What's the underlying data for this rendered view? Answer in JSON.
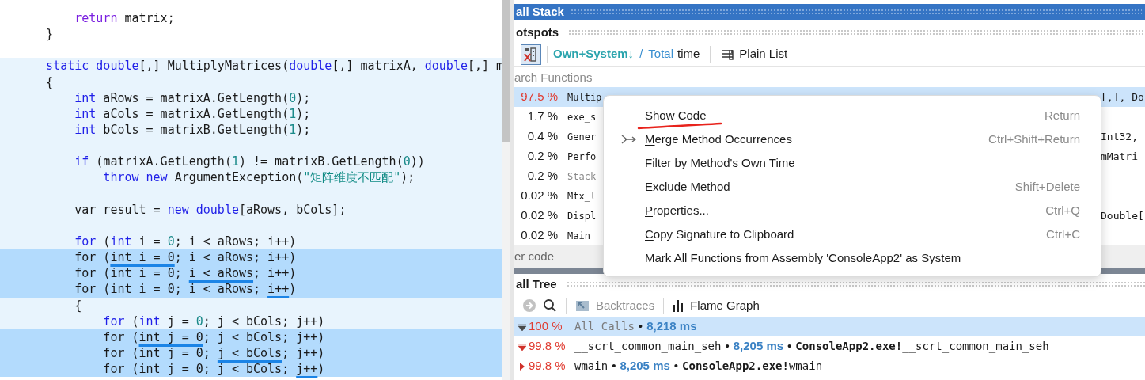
{
  "editor": {
    "lines": [
      {
        "selected": false,
        "tokens": [
          {
            "kind": "flow",
            "text": "        return"
          },
          {
            "kind": "plain",
            "text": " matrix;"
          }
        ]
      },
      {
        "selected": false,
        "tokens": [
          {
            "kind": "plain",
            "text": "    }"
          }
        ]
      },
      {
        "kind": "blank"
      }
    ],
    "scope": {
      "highlighted": true,
      "lines": [
        {
          "selected": false,
          "tokens": [
            {
              "kind": "keyword",
              "text": "    static double"
            },
            {
              "kind": "plain",
              "text": "[,] MultiplyMatrices("
            },
            {
              "kind": "keyword",
              "text": "double"
            },
            {
              "kind": "plain",
              "text": "[,] matrixA, "
            },
            {
              "kind": "keyword",
              "text": "double"
            },
            {
              "kind": "plain",
              "text": "[,] m"
            }
          ]
        },
        {
          "selected": false,
          "tokens": [
            {
              "kind": "plain",
              "text": "    {"
            }
          ]
        },
        {
          "selected": false,
          "tokens": [
            {
              "kind": "keyword",
              "text": "        int"
            },
            {
              "kind": "plain",
              "text": " aRows = matrixA.GetLength("
            },
            {
              "kind": "number",
              "text": "0"
            },
            {
              "kind": "plain",
              "text": ");"
            }
          ]
        },
        {
          "selected": false,
          "tokens": [
            {
              "kind": "keyword",
              "text": "        int"
            },
            {
              "kind": "plain",
              "text": " aCols = matrixA.GetLength("
            },
            {
              "kind": "number",
              "text": "1"
            },
            {
              "kind": "plain",
              "text": ");"
            }
          ]
        },
        {
          "selected": false,
          "tokens": [
            {
              "kind": "keyword",
              "text": "        int"
            },
            {
              "kind": "plain",
              "text": " bCols = matrixB.GetLength("
            },
            {
              "kind": "number",
              "text": "1"
            },
            {
              "kind": "plain",
              "text": ");"
            }
          ]
        },
        {
          "kind": "blank"
        },
        {
          "selected": false,
          "tokens": [
            {
              "kind": "keyword",
              "text": "        if"
            },
            {
              "kind": "plain",
              "text": " (matrixA.GetLength("
            },
            {
              "kind": "number",
              "text": "1"
            },
            {
              "kind": "plain",
              "text": ") != matrixB.GetLength("
            },
            {
              "kind": "number",
              "text": "0"
            },
            {
              "kind": "plain",
              "text": "))"
            }
          ]
        },
        {
          "selected": false,
          "tokens": [
            {
              "kind": "keyword",
              "text": "            throw new"
            },
            {
              "kind": "plain",
              "text": " ArgumentException("
            },
            {
              "kind": "string",
              "text": "\"矩阵维度不匹配\""
            },
            {
              "kind": "plain",
              "text": ");"
            }
          ]
        },
        {
          "kind": "blank"
        },
        {
          "selected": false,
          "tokens": [
            {
              "kind": "plain",
              "text": "        var result = "
            },
            {
              "kind": "keyword",
              "text": "new double"
            },
            {
              "kind": "plain",
              "text": "[aRows, bCols];"
            }
          ]
        },
        {
          "kind": "blank"
        },
        {
          "selected": false,
          "tokens": [
            {
              "kind": "keyword",
              "text": "        for"
            },
            {
              "kind": "plain",
              "text": " ("
            },
            {
              "kind": "keyword",
              "text": "int"
            },
            {
              "kind": "plain",
              "text": " i = "
            },
            {
              "kind": "number",
              "text": "0"
            },
            {
              "kind": "plain",
              "text": "; i < aRows; i++)"
            }
          ]
        },
        {
          "selected": true,
          "tokens": [
            {
              "kind": "plain",
              "text": "        for ("
            },
            {
              "kind": "underlined",
              "text": "int i = 0"
            },
            {
              "kind": "plain",
              "text": "; i < aRows; i++)"
            }
          ]
        },
        {
          "selected": true,
          "tokens": [
            {
              "kind": "plain",
              "text": "        for (int i = 0; "
            },
            {
              "kind": "underlined",
              "text": "i < aRows"
            },
            {
              "kind": "plain",
              "text": "; i++)"
            }
          ]
        },
        {
          "selected": true,
          "tokens": [
            {
              "kind": "plain",
              "text": "        for (int i = 0; i < aRows; "
            },
            {
              "kind": "underlined",
              "text": "i++"
            },
            {
              "kind": "plain",
              "text": ")"
            }
          ]
        },
        {
          "selected": false,
          "tokens": [
            {
              "kind": "plain",
              "text": "        {"
            }
          ]
        },
        {
          "selected": false,
          "tokens": [
            {
              "kind": "keyword",
              "text": "            for"
            },
            {
              "kind": "plain",
              "text": " ("
            },
            {
              "kind": "keyword",
              "text": "int"
            },
            {
              "kind": "plain",
              "text": " j = "
            },
            {
              "kind": "number",
              "text": "0"
            },
            {
              "kind": "plain",
              "text": "; j < bCols; j++)"
            }
          ]
        },
        {
          "selected": true,
          "tokens": [
            {
              "kind": "plain",
              "text": "            for ("
            },
            {
              "kind": "underlined",
              "text": "int j = 0"
            },
            {
              "kind": "plain",
              "text": "; j < bCols; j++)"
            }
          ]
        },
        {
          "selected": true,
          "tokens": [
            {
              "kind": "plain",
              "text": "            for (int j = 0; "
            },
            {
              "kind": "underlined",
              "text": "j < bCols"
            },
            {
              "kind": "plain",
              "text": "; j++)"
            }
          ]
        },
        {
          "selected": true,
          "tokens": [
            {
              "kind": "plain",
              "text": "            for (int j = 0; j < bCols; "
            },
            {
              "kind": "underlined",
              "text": "j++"
            },
            {
              "kind": "plain",
              "text": ")"
            }
          ]
        }
      ]
    }
  },
  "profiler": {
    "title": "all Stack",
    "hotspots": {
      "title": "otspots",
      "toolbar": {
        "filter_pressed": true,
        "sort_by": "Own+System↓",
        "slash": "/",
        "alt_sort": "Total",
        "suffix": "time",
        "view": "Plain List"
      },
      "search_placeholder": "arch Functions",
      "rows": [
        {
          "percent": "97.5 %",
          "color": "#e03c31",
          "name": "Multip",
          "tail": "[,], Do",
          "selected": true,
          "dimmed": false
        },
        {
          "percent": "1.7 %",
          "color": "#1a1a1a",
          "name": "exe_s",
          "selected": false,
          "dimmed": false
        },
        {
          "percent": "0.4 %",
          "color": "#1a1a1a",
          "name": "Gener",
          "tail": "Int32,",
          "selected": false,
          "dimmed": false
        },
        {
          "percent": "0.2 %",
          "color": "#1a1a1a",
          "name": "Perfo",
          "tail": "mMatri",
          "selected": false,
          "dimmed": false
        },
        {
          "percent": "0.2 %",
          "color": "#1a1a1a",
          "name": "Stack",
          "selected": false,
          "dimmed": true
        },
        {
          "percent": "0.02 %",
          "color": "#1a1a1a",
          "name": "Mtx_l",
          "selected": false,
          "dimmed": false
        },
        {
          "percent": "0.02 %",
          "color": "#1a1a1a",
          "name": "Displ",
          "tail": "Double[",
          "selected": false,
          "dimmed": false
        },
        {
          "percent": "0.02 %",
          "color": "#1a1a1a",
          "name": "Main",
          "selected": false,
          "dimmed": false
        }
      ],
      "footer": "er code"
    },
    "call_tree": {
      "title": "all Tree",
      "toolbar": {
        "backtraces": "Backtraces",
        "backtraces_disabled": true,
        "flame_graph": "Flame Graph"
      },
      "nodes": [
        {
          "percent": "100 %",
          "selected": true,
          "expanded": true,
          "parts": [
            {
              "kind": "synthetic",
              "text": "All Calls"
            },
            {
              "kind": "bullet",
              "text": "•"
            },
            {
              "kind": "time",
              "text": "8,218 ms"
            }
          ],
          "children": [
            {
              "percent": "99.8 %",
              "selected": false,
              "expanded": true,
              "parts": [
                {
                  "kind": "name",
                  "text": "__scrt_common_main_seh"
                },
                {
                  "kind": "bullet",
                  "text": "•"
                },
                {
                  "kind": "time",
                  "text": "8,205 ms"
                },
                {
                  "kind": "bullet",
                  "text": "•"
                },
                {
                  "kind": "module",
                  "text": "ConsoleApp2.exe!"
                },
                {
                  "kind": "name",
                  "text": "__scrt_common_main_seh"
                }
              ],
              "children": [
                {
                  "percent": "99.8 %",
                  "selected": false,
                  "expanded": false,
                  "parts": [
                    {
                      "kind": "name",
                      "text": "wmain"
                    },
                    {
                      "kind": "bullet",
                      "text": "•"
                    },
                    {
                      "kind": "time",
                      "text": "8,205 ms"
                    },
                    {
                      "kind": "bullet",
                      "text": "•"
                    },
                    {
                      "kind": "module",
                      "text": "ConsoleApp2.exe!"
                    },
                    {
                      "kind": "name",
                      "text": "wmain"
                    }
                  ]
                }
              ]
            }
          ]
        }
      ]
    },
    "context_menu": {
      "items": [
        {
          "label": "Show Code",
          "shortcut": "Return",
          "mnemonic": false,
          "icon": false
        },
        {
          "label": "Merge Method Occurrences",
          "shortcut": "Ctrl+Shift+Return",
          "mnemonic": true,
          "icon": true
        },
        {
          "label": "Filter by Method's Own Time",
          "mnemonic": false,
          "icon": false
        },
        {
          "label": "Exclude Method",
          "shortcut": "Shift+Delete",
          "mnemonic": false,
          "icon": false
        },
        {
          "label": "Properties...",
          "shortcut": "Ctrl+Q",
          "mnemonic": true,
          "icon": false
        },
        {
          "label": "Copy Signature to Clipboard",
          "shortcut": "Ctrl+C",
          "mnemonic": true,
          "icon": false
        },
        {
          "label": "Mark All Functions from Assembly 'ConsoleApp2' as System",
          "mnemonic": false,
          "icon": false
        }
      ]
    }
  }
}
